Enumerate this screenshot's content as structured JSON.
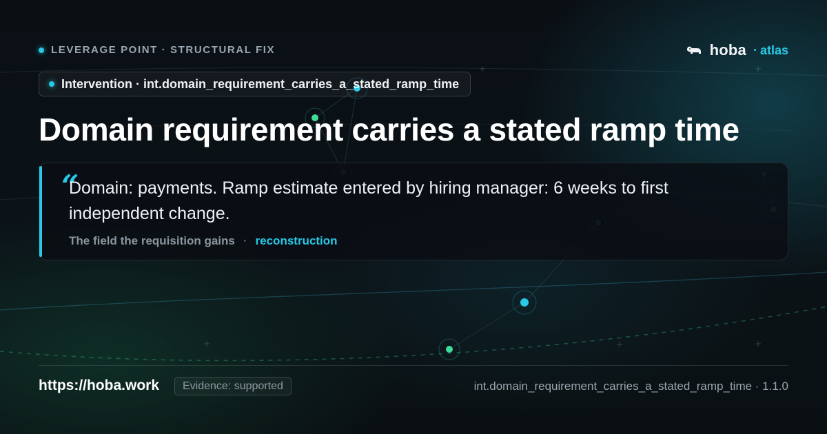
{
  "eyebrow": {
    "text": "LEVERAGE POINT · STRUCTURAL FIX"
  },
  "brand": {
    "name": "hoba",
    "separator": "·",
    "product": "atlas",
    "logo_icon": "dog-icon"
  },
  "intervention_pill": {
    "text": "Intervention · int.domain_requirement_carries_a_stated_ramp_time"
  },
  "title": "Domain requirement carries a stated ramp time",
  "quote": {
    "mark": "“",
    "text": "Domain: payments. Ramp estimate entered by hiring manager: 6 weeks to first independent change.",
    "source": "The field the requisition gains",
    "separator": "·",
    "tag": "reconstruction"
  },
  "footer": {
    "url": "https://hoba.work",
    "evidence_badge": "Evidence: supported",
    "identifier": "int.domain_requirement_carries_a_stated_ramp_time · 1.1.0"
  },
  "colors": {
    "accent": "#28c8e6",
    "node_green": "#3ddc97",
    "background": "#090d12"
  }
}
